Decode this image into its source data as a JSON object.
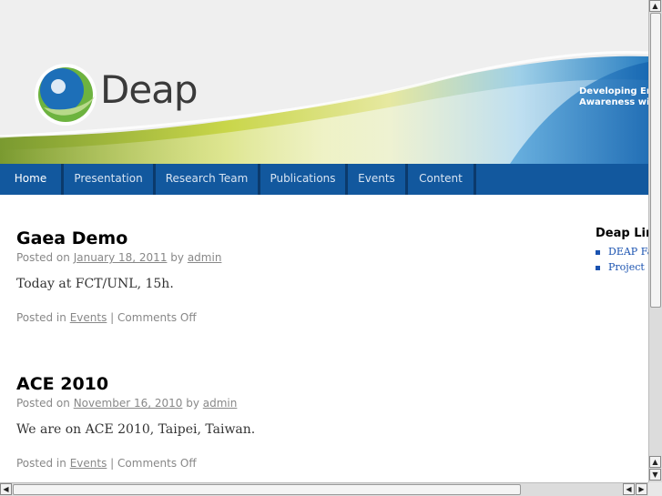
{
  "header": {
    "logo_text": "Deap",
    "tagline_line1": "Developing Env",
    "tagline_line2": "Awareness wit"
  },
  "nav": {
    "items": [
      {
        "label": "Home",
        "active": true
      },
      {
        "label": "Presentation"
      },
      {
        "label": "Research Team"
      },
      {
        "label": "Publications"
      },
      {
        "label": "Events"
      },
      {
        "label": "Content"
      }
    ]
  },
  "posts": [
    {
      "title": "Gaea Demo",
      "posted_on_label": "Posted on",
      "date": "January 18, 2011",
      "by_label": "by",
      "author": "admin",
      "content": "Today at FCT/UNL, 15h.",
      "posted_in_label": "Posted in",
      "category": "Events",
      "separator": "|",
      "comments": "Comments Off"
    },
    {
      "title": "ACE 2010",
      "posted_on_label": "Posted on",
      "date": "November 16, 2010",
      "by_label": "by",
      "author": "admin",
      "content": "We are on ACE 2010, Taipei, Taiwan.",
      "posted_in_label": "Posted in",
      "category": "Events",
      "separator": "|",
      "comments": "Comments Off"
    }
  ],
  "sidebar": {
    "title": "Deap Lin",
    "links": [
      "DEAP Fac",
      "Project Su"
    ]
  },
  "colors": {
    "nav_bg": "#12589e",
    "link": "#1a52b0",
    "logo_green": "#6db33f",
    "logo_blue": "#1d6fb8"
  }
}
